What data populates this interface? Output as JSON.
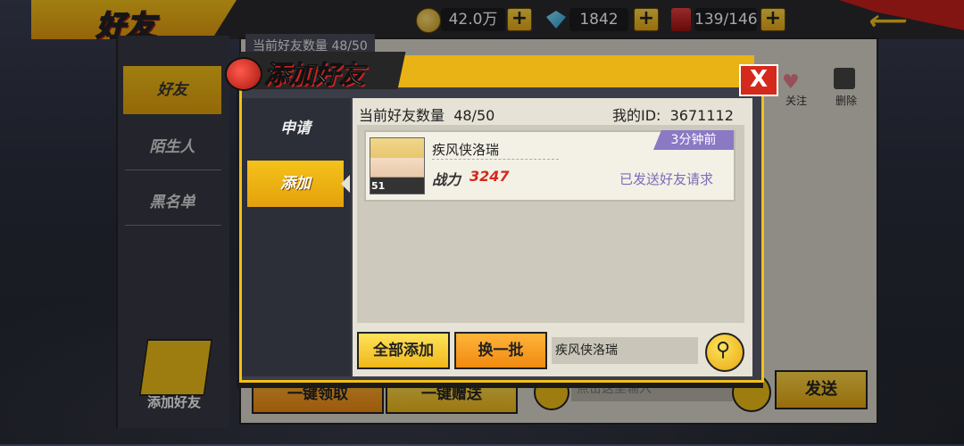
{
  "header": {
    "title": "好友",
    "gold": "42.0万",
    "diamonds": "1842",
    "stamina": "139/146",
    "plus": "+"
  },
  "sidebar": {
    "items": [
      {
        "label": "好友"
      },
      {
        "label": "陌生人"
      },
      {
        "label": "黑名单"
      }
    ],
    "add_friend_label": "添加好友"
  },
  "back_panel": {
    "friend_count": "当前好友数量  48/50",
    "one_key_claim": "一键领取",
    "one_key_gift": "一键赠送",
    "input_placeholder": "点击这里输入",
    "send": "发送",
    "follow": "关注",
    "delete": "删除"
  },
  "dialog": {
    "title": "添加好友",
    "close": "X",
    "tabs": [
      {
        "label": "申请"
      },
      {
        "label": "添加"
      }
    ],
    "friend_count_label": "当前好友数量",
    "friend_count_value": "48/50",
    "my_id_label": "我的ID:",
    "my_id_value": "3671112",
    "players": [
      {
        "name": "疾风侠洛瑞",
        "level": "51",
        "power_label": "战力",
        "power": "3247",
        "time": "3分钟前",
        "status": "已发送好友请求"
      }
    ],
    "add_all": "全部添加",
    "refresh": "换一批",
    "search_value": "疾风侠洛瑞",
    "search_icon": "magnifier-icon"
  },
  "colors": {
    "accent_yellow": "#f2c01a",
    "close_red": "#d42a1c",
    "power_red": "#d42a1c",
    "status_purple": "#7c6bb8",
    "badge_purple": "#8b79c4"
  }
}
